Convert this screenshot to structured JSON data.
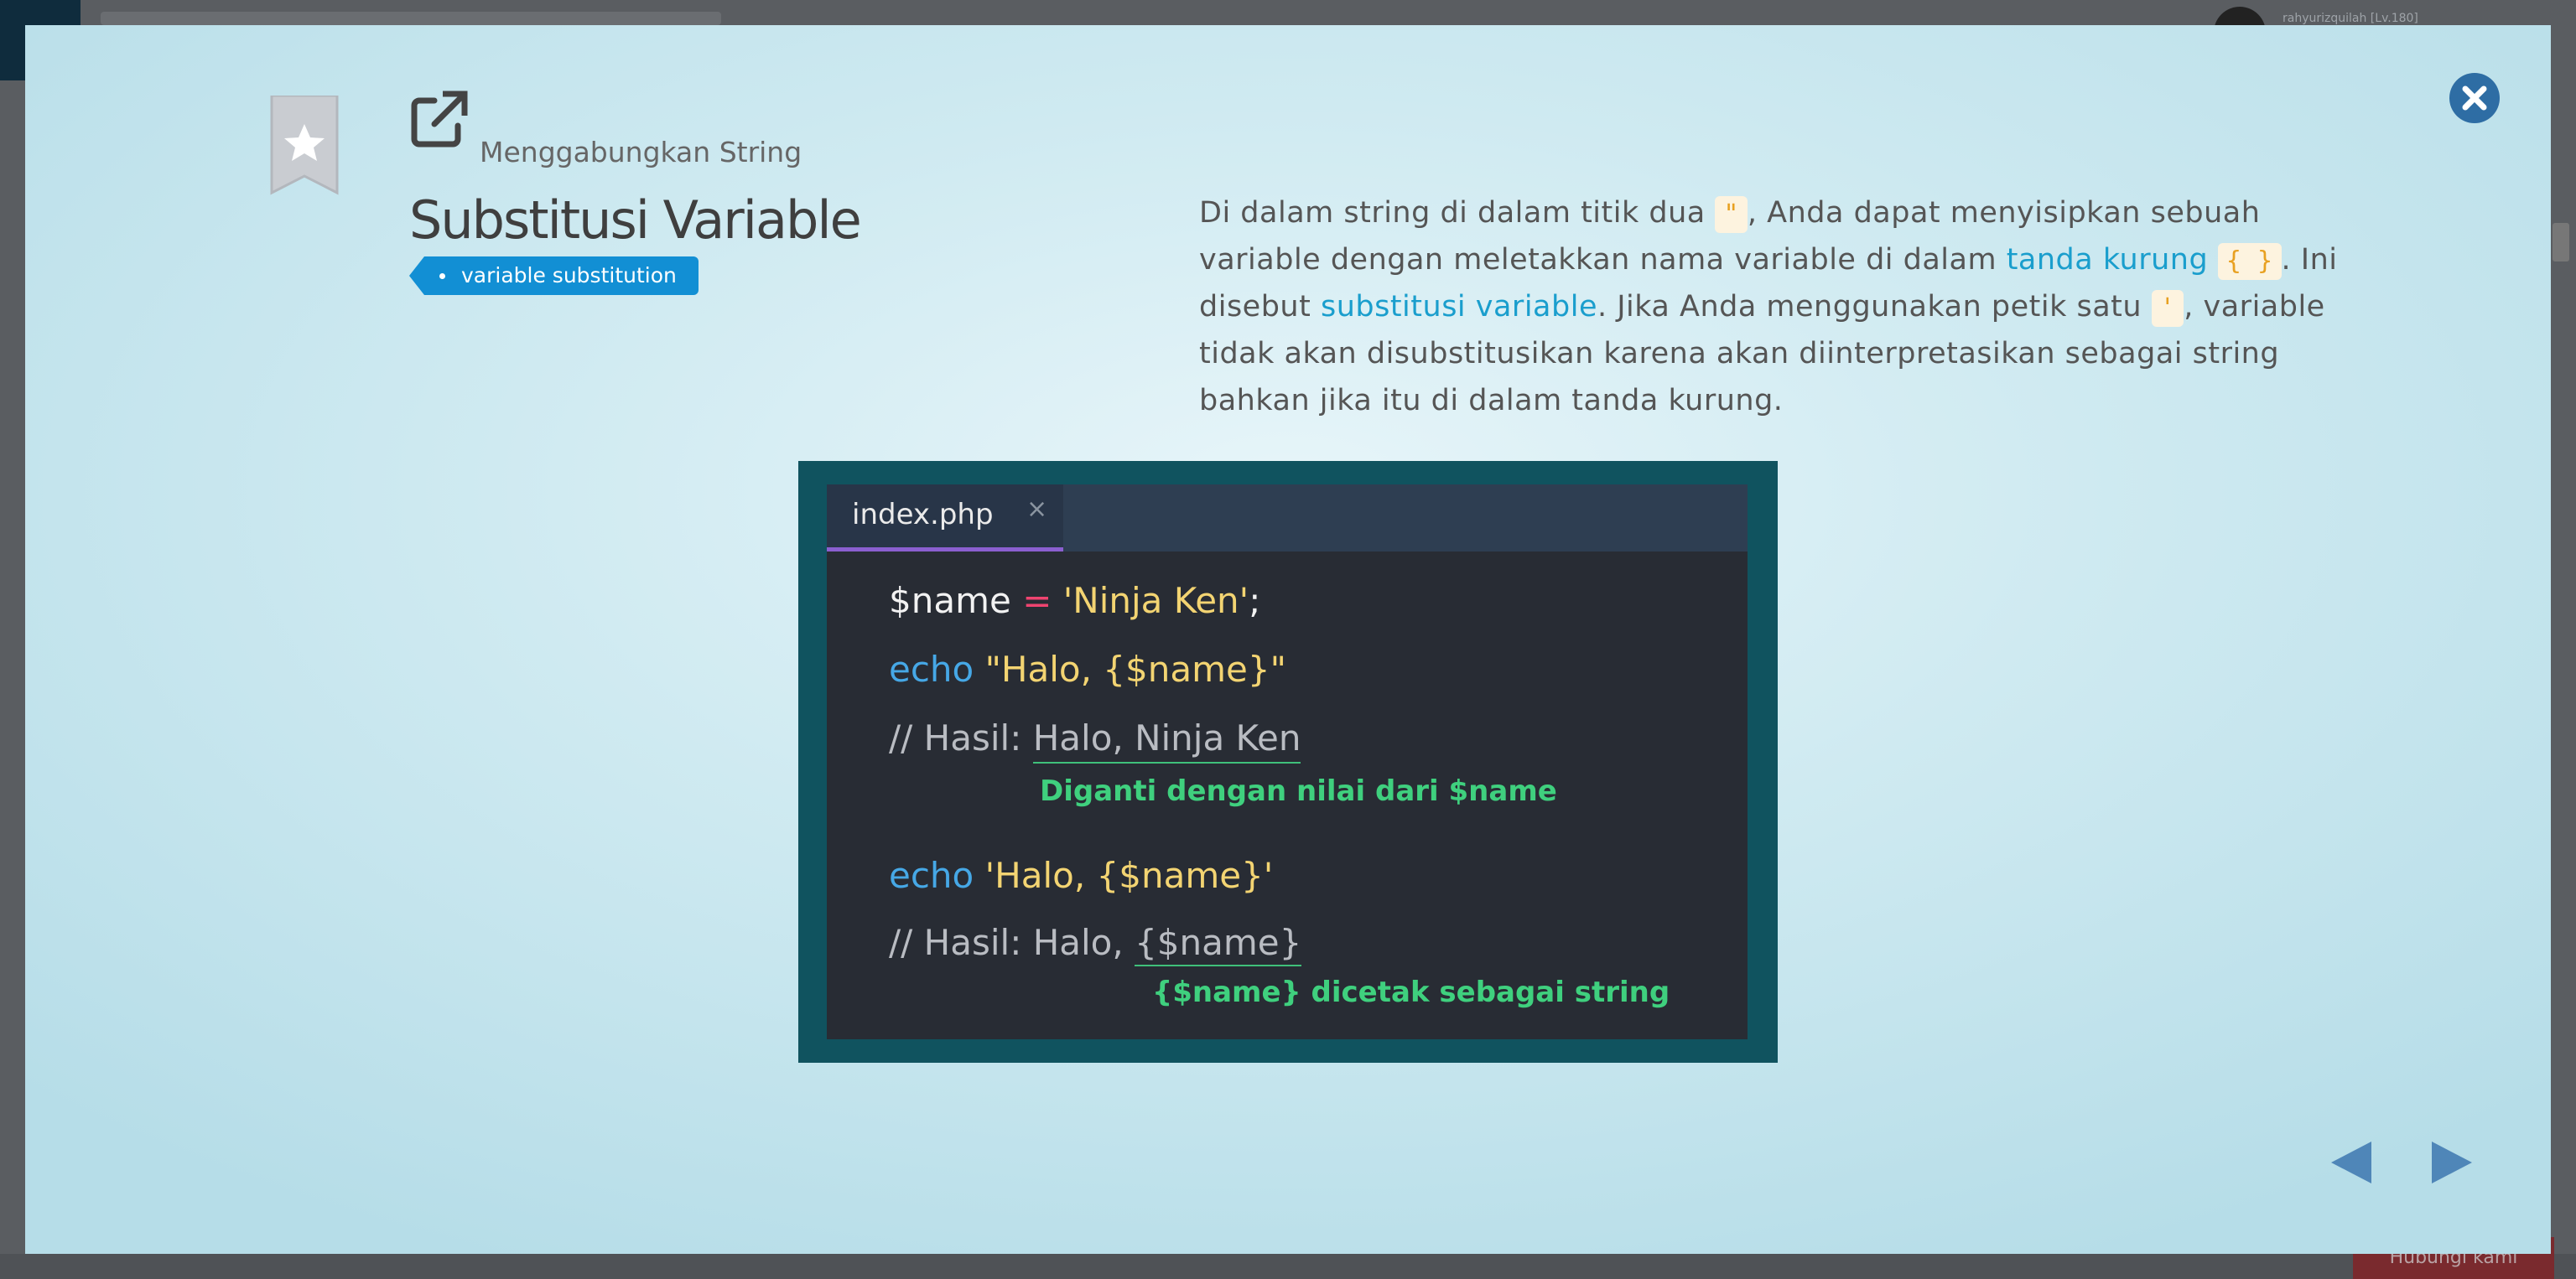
{
  "background": {
    "user_label": "rahyurizquilah [Lv.180]",
    "bottom_button_label": "Hubungi kami"
  },
  "modal": {
    "breadcrumb": "Menggabungkan String",
    "title": "Substitusi Variable",
    "tag": "variable substitution",
    "description": {
      "p1": "Di dalam string di dalam titik dua ",
      "chip1": "\"",
      "p2": ", Anda dapat menyisipkan sebuah variable dengan meletakkan nama variable di dalam ",
      "link1": "tanda kurung",
      "chip2": "{ }",
      "p3": ". Ini disebut ",
      "link2": "substitusi variable",
      "p4": ". Jika Anda menggunakan petik satu ",
      "chip3": "'",
      "p5": ", variable tidak akan disubstitusikan karena akan diinterpretasikan sebagai string bahkan jika itu di dalam tanda kurung."
    },
    "code": {
      "tab_name": "index.php",
      "tab_close": "×",
      "line1": {
        "var": "$name",
        "op": " = ",
        "str": "'Ninja Ken'",
        "end": ";"
      },
      "line2": {
        "kw": "echo",
        "str": " \"Halo, {$name}\""
      },
      "line3": {
        "comment": "// Hasil: ",
        "result": "Halo, Ninja Ken"
      },
      "note1": "Diganti dengan nilai dari $name",
      "line4": {
        "kw": "echo",
        "str": " 'Halo, {$name}'"
      },
      "line5": {
        "comment": "// Hasil: Halo, ",
        "result": "{$name}"
      },
      "note2": "{$name} dicetak sebagai string"
    },
    "colors": {
      "accent": "#128fd4",
      "link": "#1a9ecd",
      "nav_arrow": "#4f86b8",
      "close_button": "#2e6da4"
    }
  }
}
